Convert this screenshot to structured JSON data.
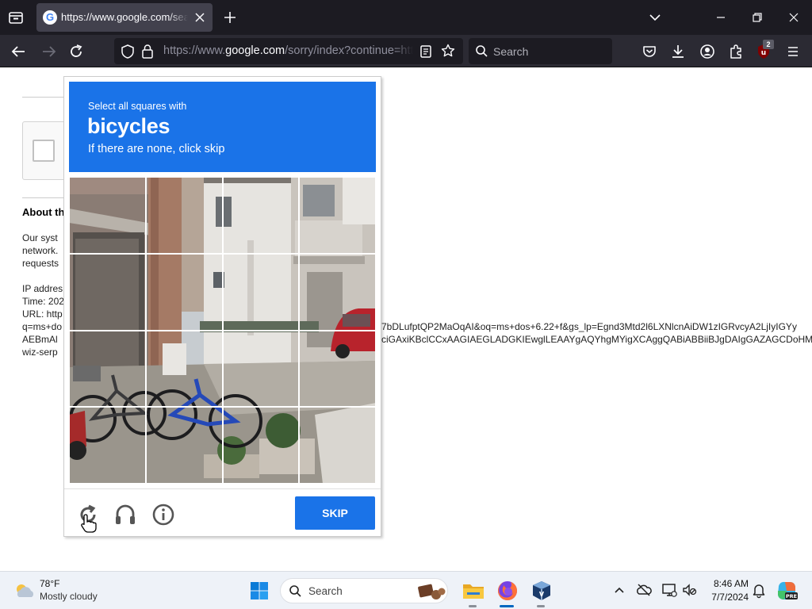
{
  "browser": {
    "tab": {
      "title": "https://www.google.com/search?q=ms+dos"
    },
    "url": {
      "prefix": "https://www.",
      "domain": "google.com",
      "path": "/sorry/index?continue=https://www.google.com/search"
    },
    "search_placeholder": "Search",
    "extension_badge": "2"
  },
  "page": {
    "heading": "About th",
    "lines": [
      "Our syst",
      "network.",
      "requests"
    ],
    "ip_label": "IP addres",
    "time_label": "Time: 202",
    "url_label": "URL: http",
    "url_lines_left": [
      "q=ms+do",
      "AEBmAl",
      "wiz-serp"
    ],
    "url_lines_right": [
      "7bDLufptQP2MaOqAI&oq=ms+dos+6.22+f&gs_lp=Egnd3Mtd2l6LXNlcnAiDW1zIGRvcyA2LjIyIGYy",
      "ciGAxiKBclCCxAAGIAEGLADGKIEwglLEAAYgAQYhgMYigXCAggQABiABBiiBJgDAIgGAZAGCDoHMTM"
    ]
  },
  "captcha": {
    "instruction_line1": "Select all squares with",
    "target": "bicycles",
    "instruction_line3": "If there are none, click skip",
    "grid_rows": 4,
    "grid_cols": 4,
    "skip_label": "SKIP",
    "accent_color": "#1a73e8"
  },
  "taskbar": {
    "weather_temp": "78°F",
    "weather_desc": "Mostly cloudy",
    "search_placeholder": "Search",
    "time": "8:46 AM",
    "date": "7/7/2024"
  }
}
